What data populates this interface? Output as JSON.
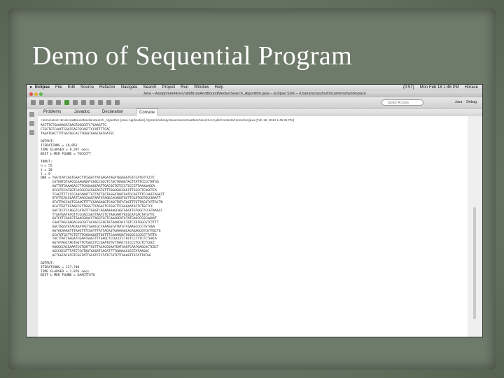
{
  "slide": {
    "title": "Demo of Sequential Program"
  },
  "mac_menubar": {
    "app": "Eclipse",
    "items": [
      "File",
      "Edit",
      "Source",
      "Refactor",
      "Navigate",
      "Search",
      "Project",
      "Run",
      "Window",
      "Help"
    ],
    "battery": "(0:57)",
    "clock": "Mon Feb 18  1:46 PM",
    "user": "Horace"
  },
  "window": {
    "title": "Java – Assignment4/src/util/BruteAndBoundMedianSearch_Algorithm.java – Eclipse SDK – /Users/sunyuhu/Documents/workspace"
  },
  "toolbar": {
    "quick_access_placeholder": "Quick Access",
    "perspectives": [
      "Java",
      "Debug"
    ]
  },
  "tabs": [
    "Problems",
    "Javadoc",
    "Declaration",
    "Console"
  ],
  "console": {
    "description": "<terminated> BruteAndBoundMedianSearch_Algorithm [Java Application] /System/Library/Java/JavaVirtualMachines/1.6.0.jdk/Contents/Home/bin/java (Feb 18, 2013 1:45:31 PM)",
    "text": "AATTTCTGAAAAGATAAGTGGGCCTCTGAAGTTC\nCTGCTGTCAACTGGATCAGTGCAGTTCCATTTTCAC\nTAGATGACTTTTGATGGCACTTGGATGAGCAATGATGC\n\nOUTPUT:\nITERATIONS = 16,052\nTIME ELAPSED = 8.297 secs.\nBEST L-MER FOUND = TGCCCTT\n\nINPUT:\nn = 55\nt = 20\nl = 9\nDNA = TGGTCATCAGTGAACTTCGGATTATGAGATAGATGGAGGTGTCCATGTTCCTC\n      CATAATGTAACGCAAGAGATCAGCCGCCTCTACTAAGATACTTATTCCCCTATGG\n      AATTCTGAAAGACCTTCAGAAGCAATTGACGGTGTCCCTCCCGTTAAAAAGCA\n      ACCATCCATGGTCACGCCGCGGCAGTGTTTGGGGACGGCCTTGCCCTCAGCTCA\n      TCAGTTTTCCCCAACAAATTGTTATTGCTAGGATAATGATGCAGTTTCCAGCCAGATT\n      GTGTTCACCGAATTAACCAAGTAATATAGGCACAGGTGCTTGCATGGTGCCGAATT\n      ATATTACCAGTGCAAGTTTTCGAAGAGGTCAGCTATATAGTTTGTTACATATTACTN\n      ACATTGTTGTAAGTGTTGGGTTCAGGCTGTGGCTTCGAGAATACTCTGCTCC\n      GACTCCTCCAGGTCATGTTTGGGTCAGAAAAAGCAGTGGGTTGTGGCTCCGTAAACC\n      TTAGTGATATGTTCCCACCAGTTAATCTCTAACAATTACGCATCACTATATTC\n      GATCCTCAGCCTGAACGAACCTAGGTCCTCAAAGCATATATGAGCCCGCAAAAT\n      CAACTAGCGAGACGGCGCTACAGCGTAGTATAAACACCTGTCTATGGCGTCTTTT\n      GGCTGGGTATACAAATACTGAACGCTAAAGGTATGTGTCGAAGCCCCTGTAGA\n      AGTACAAAATTTAAGTTTCAATTTATTACAGTGAAAAGCACAGAGCGTCGTTGCTG\n      GCATCTGCTTCTGTTTCAGAGGGTTGGTTTCAAAAGATACGGCCCGCCTTATTA\n      TACTTATTGGGATCGAATGAGTTTTGAGCTCCGCCTCTACTCCTTTCTCTGACA\n      AGTATAGCTAGTGGTTCTGGCCTCCGAATGTGTTAACTCCCCCTCCTCTCACC\n      AGGCCCACGAAATCGTGATTGCTTACACCGAATGATGAGTCAATGAGCACTCGCT\n      AGCCGCGTTTATCTCGTAATGAGATCACATTTTAAAAACCCGTATAAGAC\n      ACTGGCACGTGTCGGTATTGCATCTCTATCTATCTTAAAGTTATATTATGG\n\nOUTPUT:\nITERATIONS = 137,740\nTIME ELAPSED = 1.876 secs.\nBEST L-MER FOUND = AAACTTATG"
  }
}
